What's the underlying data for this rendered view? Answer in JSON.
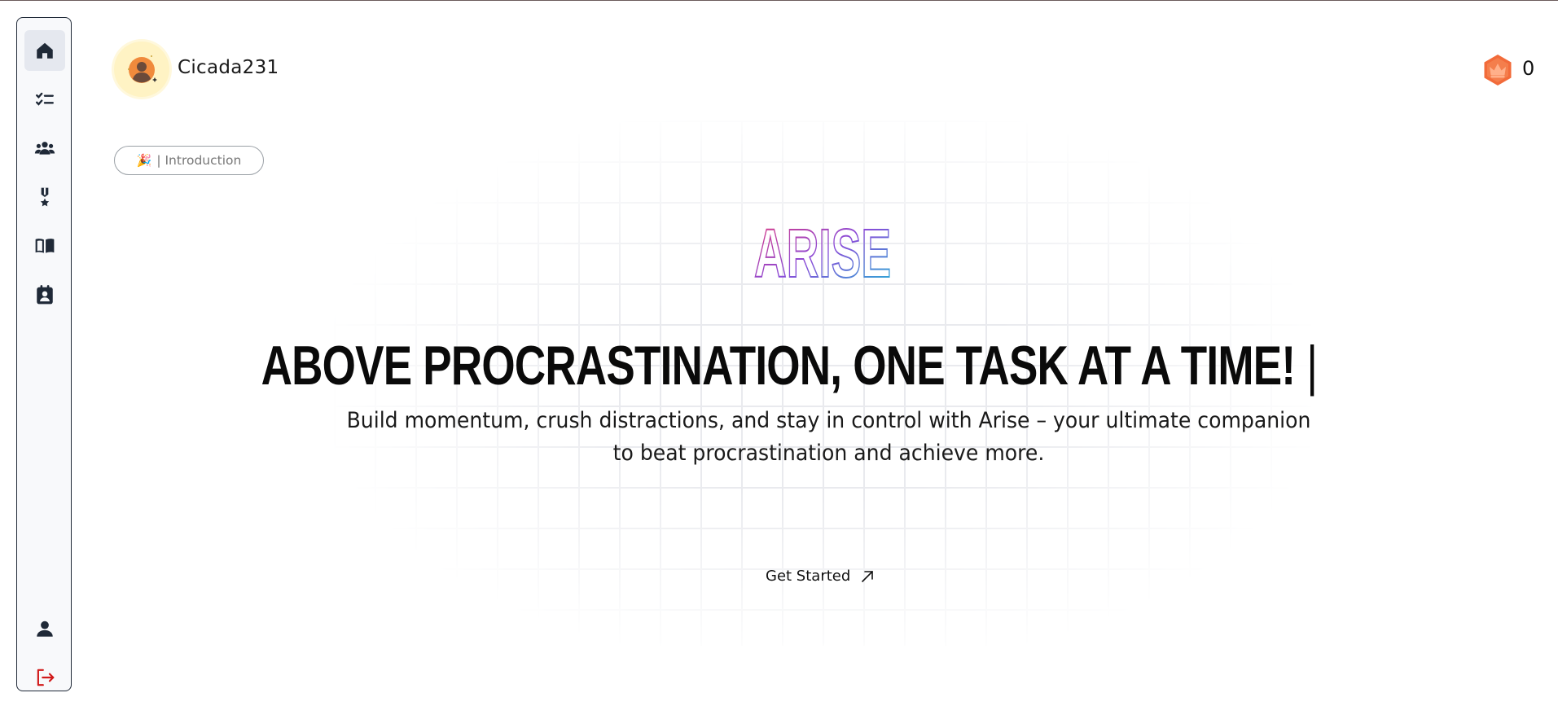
{
  "user": {
    "name": "Cicada231"
  },
  "coins": {
    "count": "0",
    "icon": "crown-badge-icon",
    "color": "#f26b3a"
  },
  "sidebar": {
    "items": [
      {
        "name": "home",
        "icon": "home-icon",
        "active": true
      },
      {
        "name": "tasks",
        "icon": "checklist-icon"
      },
      {
        "name": "community",
        "icon": "users-icon"
      },
      {
        "name": "achievements",
        "icon": "medal-icon"
      },
      {
        "name": "journal",
        "icon": "book-open-icon"
      },
      {
        "name": "planner",
        "icon": "contact-calendar-icon"
      }
    ],
    "bottom": [
      {
        "name": "profile",
        "icon": "user-icon"
      },
      {
        "name": "logout",
        "icon": "logout-icon",
        "color": "#d11a1a"
      }
    ]
  },
  "intro_pill": {
    "emoji": "🎉",
    "label": "| Introduction"
  },
  "hero": {
    "logo_text": "ARISE",
    "headline": "ABOVE PROCRASTINATION, ONE TASK AT A TIME!",
    "caret": "|",
    "subtitle_line1": "Build momentum, crush distractions, and stay in control with Arise – your ultimate companion",
    "subtitle_line2": "to beat procrastination and achieve more.",
    "cta_label": "Get Started"
  },
  "colors": {
    "logo_gradient": [
      "#e6397a",
      "#8a4bd8",
      "#1fb6d6"
    ],
    "sidebar_border": "#1f2937",
    "logout": "#d11a1a"
  }
}
